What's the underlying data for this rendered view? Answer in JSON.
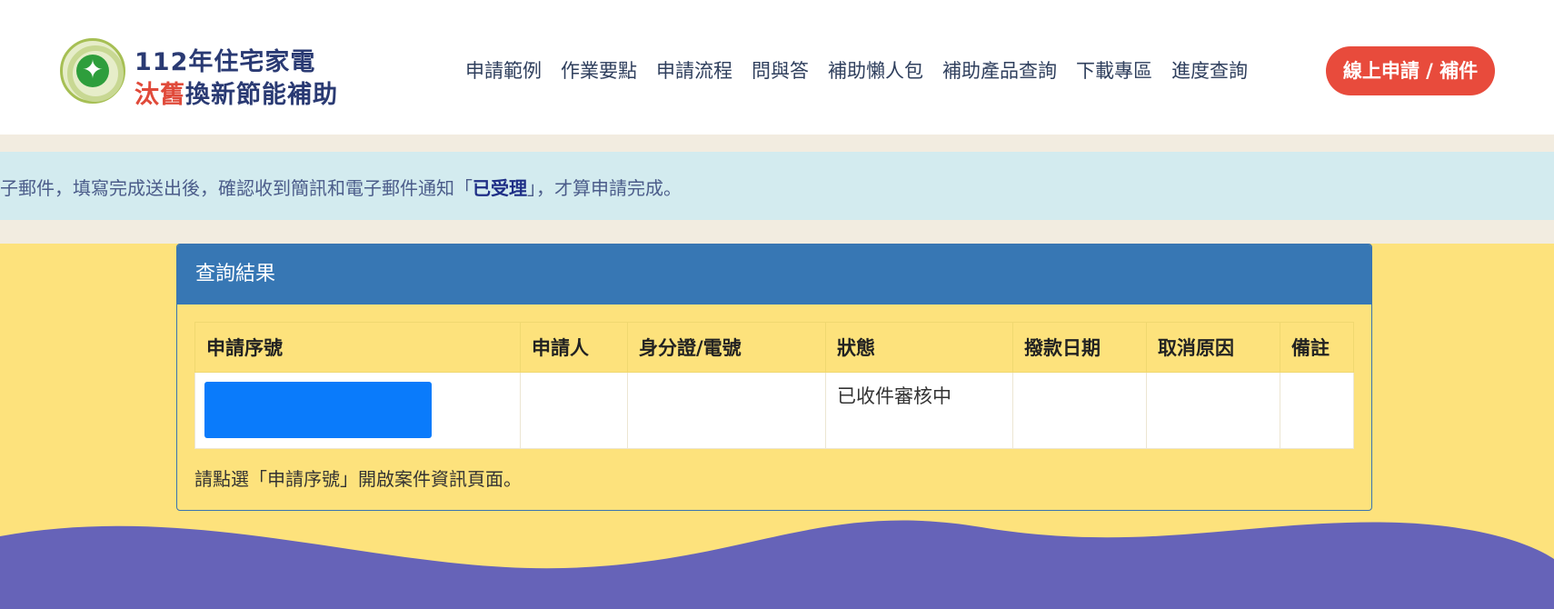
{
  "logo": {
    "line1": "112年住宅家電",
    "line2_red": "汰舊",
    "line2_rest": "換新節能補助",
    "emblem": "bureau-of-energy-emblem"
  },
  "nav": {
    "items": [
      "申請範例",
      "作業要點",
      "申請流程",
      "問與答",
      "補助懶人包",
      "補助產品查詢",
      "下載專區",
      "進度查詢"
    ],
    "apply_label": "線上申請 / 補件"
  },
  "notice": {
    "pre": "子郵件，填寫完成送出後，確認收到簡訊和電子郵件通知「",
    "highlight": "已受理",
    "post": "」，才算申請完成。"
  },
  "results": {
    "title": "查詢結果",
    "columns": [
      "申請序號",
      "申請人",
      "身分證/電號",
      "狀態",
      "撥款日期",
      "取消原因",
      "備註"
    ],
    "rows": [
      {
        "serial": "",
        "applicant": "",
        "id_phone": "",
        "status": "已收件審核中",
        "payment_date": "",
        "cancel_reason": "",
        "remark": ""
      }
    ],
    "footnote": "請點選「申請序號」開啟案件資訊頁面。"
  },
  "colors": {
    "header_bg": "#ffffff",
    "apply_btn": "#e84b3c",
    "notice_bg": "#d3ebef",
    "card_head": "#3777b4",
    "page_bg": "#fde27c",
    "wave": "#6663b8",
    "serial_link_block": "#0a7bfb"
  }
}
